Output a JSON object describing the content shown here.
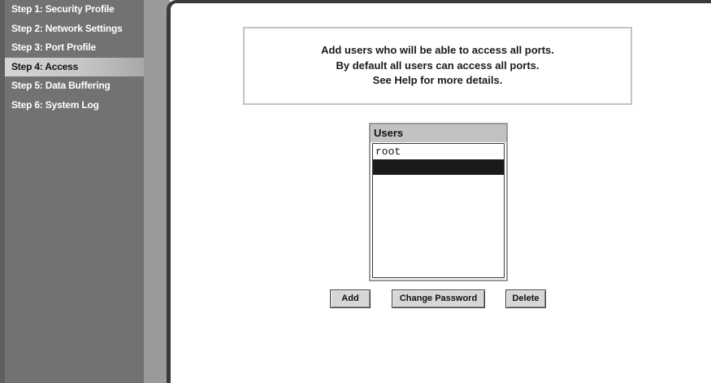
{
  "sidebar": {
    "items": [
      {
        "label": "Step 1: Security Profile"
      },
      {
        "label": "Step 2: Network Settings"
      },
      {
        "label": "Step 3: Port Profile"
      },
      {
        "label": "Step 4: Access"
      },
      {
        "label": "Step 5: Data Buffering"
      },
      {
        "label": "Step 6: System Log"
      }
    ],
    "active_index": 3
  },
  "info": {
    "lines": [
      "Add users who will be able to access all ports.",
      "By default all users can access all ports.",
      "See Help for more details."
    ]
  },
  "users": {
    "header": "Users",
    "rows": [
      "root",
      ""
    ],
    "selected_index": 1
  },
  "buttons": {
    "add": "Add",
    "change_password": "Change Password",
    "delete": "Delete"
  },
  "colors": {
    "sidebar_bg": "#727272",
    "active_item_bg": "#c6c6c6",
    "selection_bg": "#1a1a1a",
    "button_bg": "#d6d6d6"
  }
}
